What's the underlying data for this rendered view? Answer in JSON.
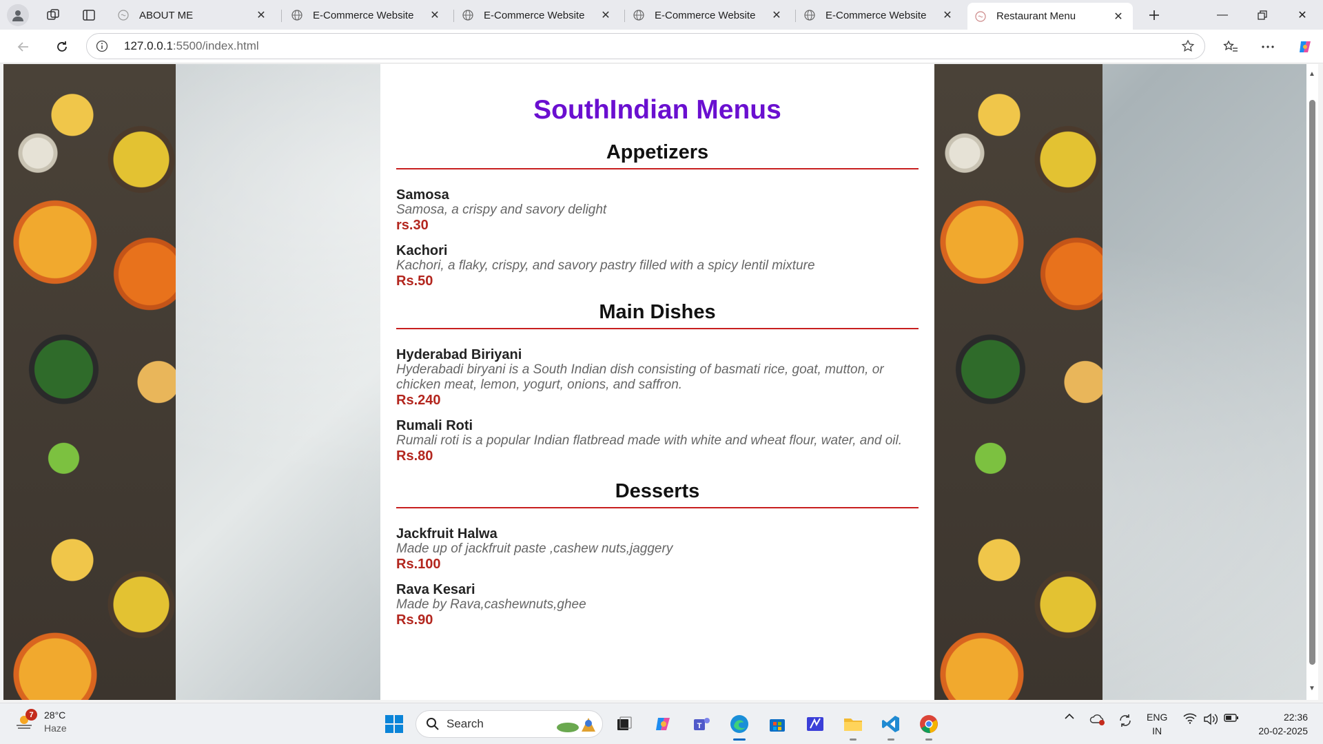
{
  "browser": {
    "tabs": [
      {
        "title": "ABOUT ME",
        "active": false,
        "favicon": "page-icon"
      },
      {
        "title": "E-Commerce Website",
        "active": false,
        "favicon": "globe-icon"
      },
      {
        "title": "E-Commerce Website",
        "active": false,
        "favicon": "globe-icon"
      },
      {
        "title": "E-Commerce Website",
        "active": false,
        "favicon": "globe-icon"
      },
      {
        "title": "E-Commerce Website",
        "active": false,
        "favicon": "globe-icon"
      },
      {
        "title": "Restaurant Menu",
        "active": true,
        "favicon": "page-icon"
      }
    ],
    "address": {
      "host": "127.0.0.1",
      "path": ":5500/index.html"
    }
  },
  "page": {
    "title": "SouthIndian Menus",
    "sections": [
      {
        "heading": "Appetizers",
        "items": [
          {
            "name": "Samosa",
            "desc": "Samosa, a crispy and savory delight",
            "price": "rs.30"
          },
          {
            "name": "Kachori",
            "desc": "Kachori, a flaky, crispy, and savory pastry filled with a spicy lentil mixture",
            "price": "Rs.50"
          }
        ]
      },
      {
        "heading": "Main Dishes",
        "items": [
          {
            "name": "Hyderabad Biriyani",
            "desc": "Hyderabadi biryani is a South Indian dish consisting of basmati rice, goat, mutton, or chicken meat, lemon, yogurt, onions, and saffron.",
            "price": "Rs.240"
          },
          {
            "name": "Rumali Roti",
            "desc": "Rumali roti is a popular Indian flatbread made with white and wheat flour, water, and oil.",
            "price": "Rs.80"
          }
        ]
      },
      {
        "heading": "Desserts",
        "items": [
          {
            "name": "Jackfruit Halwa",
            "desc": "Made up of jackfruit paste ,cashew nuts,jaggery",
            "price": "Rs.100"
          },
          {
            "name": "Rava Kesari",
            "desc": "Made by Rava,cashewnuts,ghee",
            "price": "Rs.90"
          }
        ]
      }
    ]
  },
  "taskbar": {
    "weather": {
      "temp": "28°C",
      "condition": "Haze",
      "badge": "7"
    },
    "search_label": "Search",
    "language": {
      "line1": "ENG",
      "line2": "IN"
    },
    "clock": {
      "time": "22:36",
      "date": "20-02-2025"
    }
  },
  "colors": {
    "title": "#6a0fd0",
    "price": "#b3261e",
    "divider": "#c81e1e",
    "accent": "#0067c0"
  }
}
